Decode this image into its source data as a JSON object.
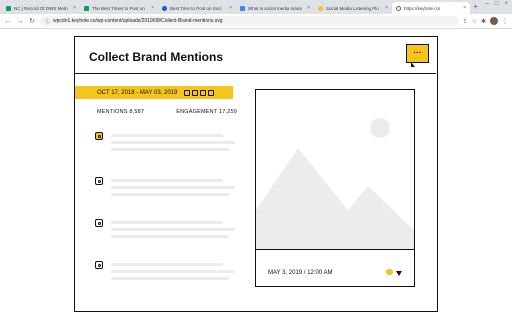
{
  "tabs": [
    {
      "title": "NC | Record Of DWS Metri",
      "color": "#0f9d58"
    },
    {
      "title": "The Best Times to Post on",
      "color": "#0f9d58"
    },
    {
      "title": "Best Time to Post on Soci",
      "color": "#1a56db"
    },
    {
      "title": "What is social media mana",
      "color": "#4285f4"
    },
    {
      "title": "Social Media Listening Plu",
      "color": "#f5c51b"
    },
    {
      "title": "https://keyhole.co/",
      "color": "#5f6368",
      "active": true
    }
  ],
  "url": "wpcdn1.keyhole.co/wp-content/uploads/2019/08/Collect-Brand-mentions.svg",
  "card": {
    "title": "Collect Brand Mentions",
    "chat_dots": "···",
    "date_range": "OCT 17, 2018 - MAY 03, 2019",
    "mentions_label": "MENTIONS 8,587",
    "engagement_label": "ENGAGEMENT 17,259",
    "post_date": "MAY 3, 2019 / 12:00 AM"
  },
  "colors": {
    "accent": "#f5c51b",
    "ink": "#111111"
  }
}
